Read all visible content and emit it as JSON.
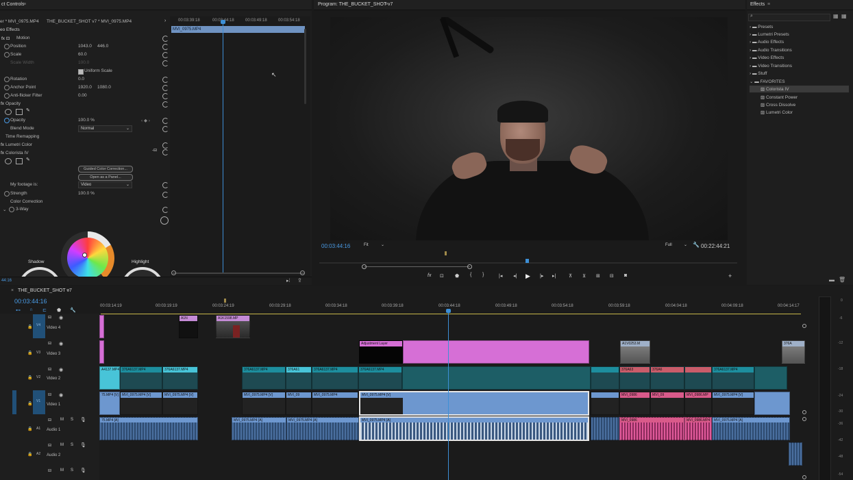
{
  "effect_controls": {
    "tab": "ct Controls",
    "source": "er * MVI_0975.MP4",
    "sequence": "THE_BUCKET_SHOT v7 * MVI_0975.MP4",
    "mini_timecodes": [
      "00:03:39:18",
      "00:03:44:18",
      "00:03:49:18",
      "00:03:54:18"
    ],
    "mini_clip": "MVI_0975.MP4",
    "video_effects_label": "eo Effects",
    "motion": "Motion",
    "position_label": "Position",
    "position_x": "1043.0",
    "position_y": "446.0",
    "scale_label": "Scale",
    "scale_val": "60.0",
    "scale_width_label": "Scale Width",
    "scale_width_val": "100.0",
    "uniform_scale": "Uniform Scale",
    "rotation_label": "Rotation",
    "rotation_val": "0.0",
    "anchor_label": "Anchor Point",
    "anchor_x": "1920.0",
    "anchor_y": "1080.0",
    "antiflicker_label": "Anti-flicker Filter",
    "antiflicker_val": "0.00",
    "opacity_group": "Opacity",
    "opacity_label": "Opacity",
    "opacity_val": "100.0 %",
    "blend_label": "Blend Mode",
    "blend_val": "Normal",
    "time_remap": "Time Remapping",
    "lumetri": "Lumetri Color",
    "colorista": "Colorista IV",
    "guided_btn": "Guided Color Correction...",
    "panel_btn": "Open as a Panel...",
    "footage_label": "My footage is:",
    "footage_val": "Video",
    "strength_label": "Strength",
    "strength_val": "100.0 %",
    "color_correction": "Color Correction",
    "three_way": "3-Way",
    "shadow": "Shadow",
    "highlight": "Highlight",
    "bottom_tc": "44:16"
  },
  "program": {
    "title": "Program: THE_BUCKET_SHOT v7",
    "timecode": "00:03:44:16",
    "fit": "Fit",
    "full": "Full",
    "duration": "00:22:44:21"
  },
  "effects": {
    "title": "Effects",
    "items": [
      "Presets",
      "Lumetri Presets",
      "Audio Effects",
      "Audio Transitions",
      "Video Effects",
      "Video Transitions",
      "Stuff",
      "FAVORITES"
    ],
    "favorites": [
      "Colorista IV",
      "Constant Power",
      "Cross Dissolve",
      "Lumetri Color"
    ]
  },
  "timeline": {
    "tab": "THE_BUCKET_SHOT v7",
    "timecode": "00:03:44:16",
    "ruler": [
      "00:03:14:19",
      "00:03:19:19",
      "00:03:24:19",
      "00:03:29:18",
      "00:03:34:18",
      "00:03:39:18",
      "00:03:44:18",
      "00:03:49:18",
      "00:03:54:18",
      "00:03:59:18",
      "00:04:04:18",
      "00:04:09:18",
      "00:04:14:17"
    ],
    "tracks": {
      "v4": "V4",
      "v4_name": "Video 4",
      "v3": "V3",
      "v3_name": "Video 3",
      "v2": "V2",
      "v2_name": "Video 2",
      "v1": "V1",
      "v1_name": "Video 1",
      "a1": "A1",
      "a1_name": "Audio 1",
      "a2": "A2",
      "a2_name": "Audio 2"
    },
    "clips": {
      "v4_a": "A1N",
      "v4_b": "A1K1598.MP",
      "v3_adj": "Adjustment Layer",
      "v3_b": "A1V0253.M",
      "v3_c": "376A",
      "v2_a": "A4137.MP4",
      "v2_b": "376A6137.MP4",
      "v2_c": "376A6137.MP4",
      "v2_d": "376A6137.MP4",
      "v2_e": "376A61",
      "v2_f": "376A6137.MP4",
      "v2_g": "376A6137.MP4",
      "v2_h": "376A63",
      "v2_i": "376A6",
      "v2_j": "376A6137.MP4",
      "v1_a": "75.MP4 [V]",
      "v1_b": "MVI_0975.MP4 [V]",
      "v1_c": "MVI_0975.MP4 [V]",
      "v1_d": "MVI_0975.MP4 [V]",
      "v1_e": "MVI_09",
      "v1_f": "MVI_0975.MP4",
      "v1_g": "MVI_0975.MP4 [V]",
      "v1_h": "MVI_0986",
      "v1_i": "MVI_09",
      "v1_j": "MVI_0986.MP",
      "v1_k": "MVI_0975.MP4 [V]",
      "a1_a": "75.MP4 [A]",
      "a1_b": "MVI_0975.MP4 [A]",
      "a1_c": "MVI_0975.MP4 [A]",
      "a1_d": "MVI_0975.MP4 [A]",
      "a1_e": "MVI_0986",
      "a1_f": "MVI_0986.MP4",
      "a1_g": "MVI_0975.MP4 [A]"
    },
    "meter": [
      "0",
      "-6",
      "-12",
      "-18",
      "-24",
      "-30",
      "-36",
      "-42",
      "-48",
      "-54"
    ]
  }
}
